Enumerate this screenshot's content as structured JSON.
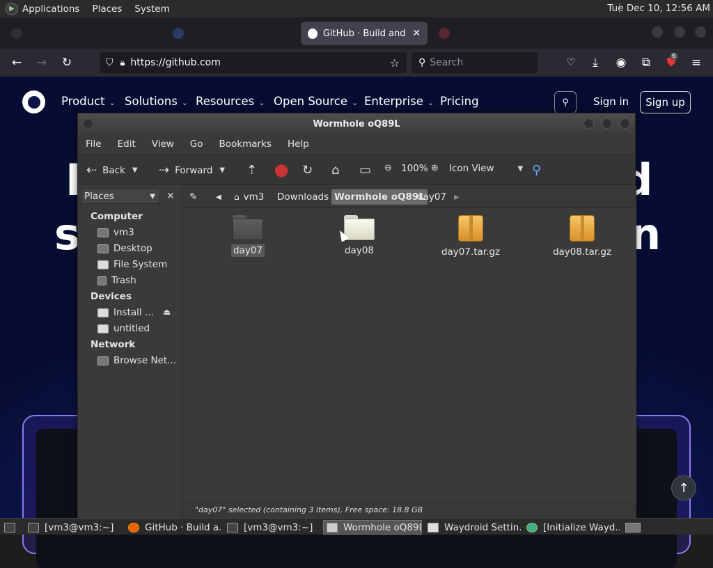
{
  "panel": {
    "menus": [
      "Applications",
      "Places",
      "System"
    ],
    "clock": "Tue Dec 10, 12:56 AM"
  },
  "browser": {
    "tabs": [
      {
        "label": "",
        "active": false
      },
      {
        "label": "",
        "active": false
      },
      {
        "label": "GitHub · Build and shi",
        "active": true
      },
      {
        "label": "",
        "active": false
      }
    ],
    "url": "https://github.com",
    "search_placeholder": "Search",
    "extension_badge": "6"
  },
  "github": {
    "nav": [
      "Product",
      "Solutions",
      "Resources",
      "Open Source",
      "Enterprise",
      "Pricing"
    ],
    "sign_in": "Sign in",
    "sign_up": "Sign up"
  },
  "filemanager": {
    "title": "Wormhole oQ89L",
    "menu": [
      "File",
      "Edit",
      "View",
      "Go",
      "Bookmarks",
      "Help"
    ],
    "toolbar": {
      "back": "Back",
      "forward": "Forward",
      "zoom": "100%",
      "view_mode": "Icon View"
    },
    "sidebar": {
      "selector": "Places",
      "sections": [
        {
          "heading": "Computer",
          "items": [
            "vm3",
            "Desktop",
            "File System",
            "Trash"
          ]
        },
        {
          "heading": "Devices",
          "items": [
            "Install ...",
            "untitled"
          ]
        },
        {
          "heading": "Network",
          "items": [
            "Browse Net..."
          ]
        }
      ]
    },
    "breadcrumbs": [
      "vm3",
      "Downloads",
      "Wormhole oQ89L",
      "day07"
    ],
    "current_crumb": "Wormhole oQ89L",
    "files": [
      {
        "name": "day07",
        "type": "folder",
        "selected": true
      },
      {
        "name": "day08",
        "type": "folder",
        "selected": false
      },
      {
        "name": "day07.tar.gz",
        "type": "archive",
        "selected": false
      },
      {
        "name": "day08.tar.gz",
        "type": "archive",
        "selected": false
      }
    ],
    "status": "\"day07\" selected (containing 3 items), Free space: 18.8 GB"
  },
  "taskbar": {
    "items": [
      {
        "label": "[vm3@vm3:~]",
        "active": false
      },
      {
        "label": "GitHub · Build a...",
        "active": false
      },
      {
        "label": "[vm3@vm3:~]",
        "active": false
      },
      {
        "label": "Wormhole oQ89L",
        "active": true
      },
      {
        "label": "Waydroid Settin...",
        "active": false
      },
      {
        "label": "[Initialize Wayd...",
        "active": false
      }
    ]
  }
}
